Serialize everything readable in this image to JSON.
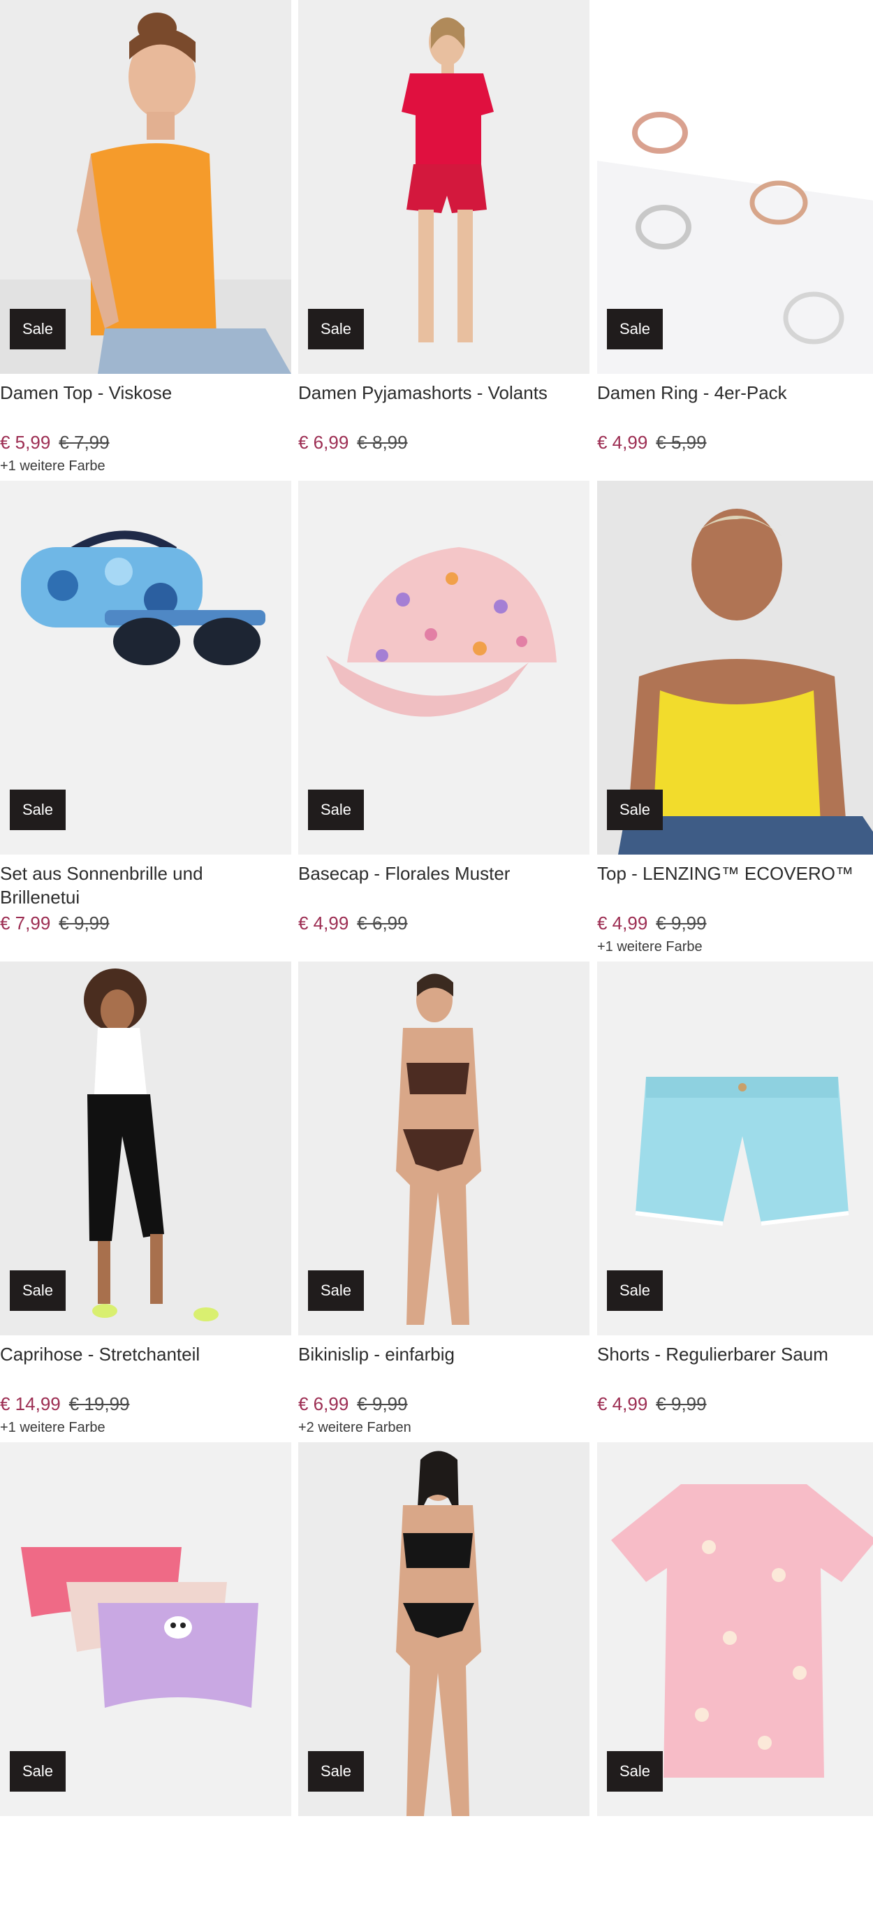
{
  "products": [
    {
      "title": "Damen Top - Viskose",
      "price": "€ 5,99",
      "old_price": "€ 7,99",
      "badge": "Sale",
      "colors": "+1 weitere Farbe",
      "image_icon": "orange-top-model-image"
    },
    {
      "title": "Damen Pyjamashorts - Volants",
      "price": "€ 6,99",
      "old_price": "€ 8,99",
      "badge": "Sale",
      "colors": "",
      "image_icon": "red-pyjama-model-image"
    },
    {
      "title": "Damen Ring - 4er-Pack",
      "price": "€ 4,99",
      "old_price": "€ 5,99",
      "badge": "Sale",
      "colors": "",
      "image_icon": "rings-image"
    },
    {
      "title": "Set aus Sonnenbrille und Brillenetui",
      "price": "€ 7,99",
      "old_price": "€ 9,99",
      "badge": "Sale",
      "colors": "",
      "image_icon": "sunglasses-case-image"
    },
    {
      "title": "Basecap - Florales Muster",
      "price": "€ 4,99",
      "old_price": "€ 6,99",
      "badge": "Sale",
      "colors": "",
      "image_icon": "floral-cap-image"
    },
    {
      "title": "Top - LENZING™ ECOVERO™",
      "price": "€ 4,99",
      "old_price": "€ 9,99",
      "badge": "Sale",
      "colors": "+1 weitere Farbe",
      "image_icon": "yellow-top-model-image"
    },
    {
      "title": "Caprihose - Stretchanteil",
      "price": "€ 14,99",
      "old_price": "€ 19,99",
      "badge": "Sale",
      "colors": "+1 weitere Farbe",
      "image_icon": "capri-pants-model-image"
    },
    {
      "title": "Bikinislip - einfarbig",
      "price": "€ 6,99",
      "old_price": "€ 9,99",
      "badge": "Sale",
      "colors": "+2 weitere Farben",
      "image_icon": "bikini-model-image"
    },
    {
      "title": "Shorts - Regulierbarer Saum",
      "price": "€ 4,99",
      "old_price": "€ 9,99",
      "badge": "Sale",
      "colors": "",
      "image_icon": "blue-shorts-image"
    },
    {
      "title": "",
      "price": "",
      "old_price": "",
      "badge": "Sale",
      "colors": "",
      "image_icon": "kids-briefs-image"
    },
    {
      "title": "",
      "price": "",
      "old_price": "",
      "badge": "Sale",
      "colors": "",
      "image_icon": "black-bikini-model-image"
    },
    {
      "title": "",
      "price": "",
      "old_price": "",
      "badge": "Sale",
      "colors": "",
      "image_icon": "pink-shirt-image"
    }
  ],
  "colors": {
    "sale_price": "#9c2d52",
    "badge_bg": "#201c1c",
    "badge_text": "#ffffff"
  }
}
